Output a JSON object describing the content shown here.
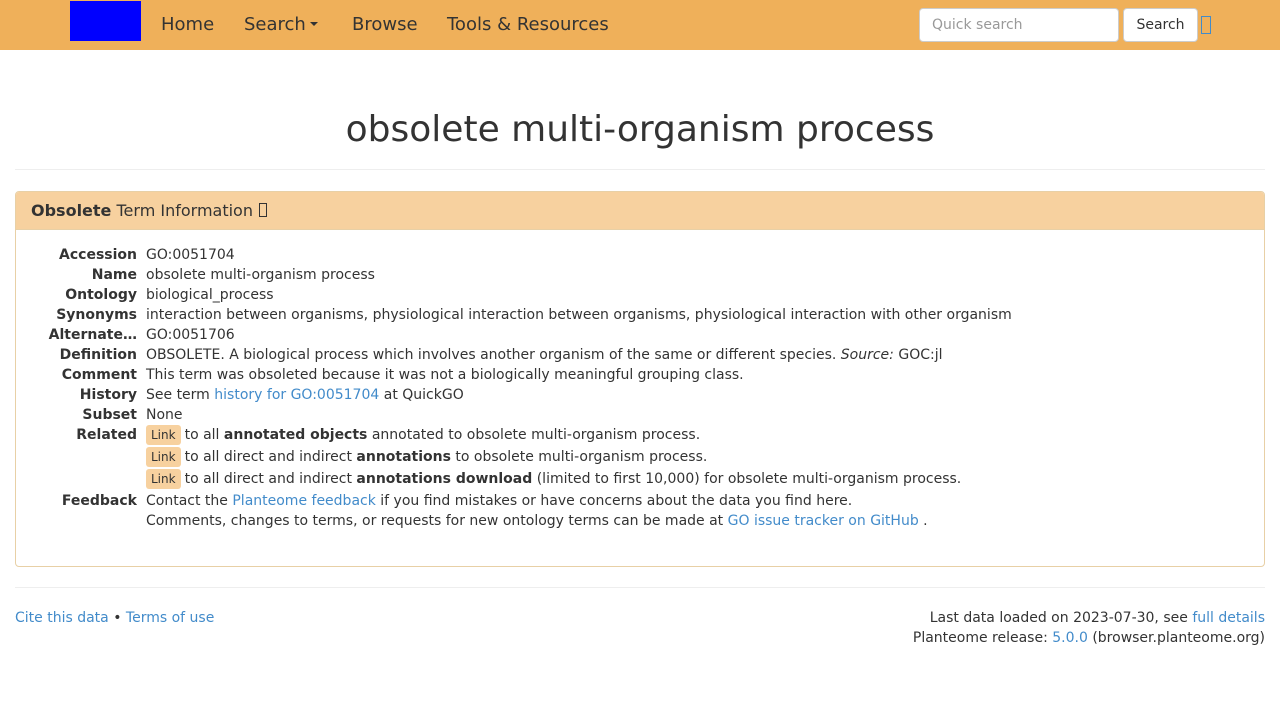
{
  "navbar": {
    "items": [
      {
        "label": "Home"
      },
      {
        "label": "Search"
      },
      {
        "label": "Browse"
      },
      {
        "label": "Tools & Resources"
      }
    ],
    "search_placeholder": "Quick search",
    "search_button": "Search",
    "colors": {
      "bar": "#efb05a",
      "logo": "#0000ff"
    }
  },
  "page_title": "obsolete multi-organism process",
  "panel": {
    "heading_bold": "Obsolete",
    "heading_rest": "Term Information",
    "fields": {
      "accession": {
        "label": "Accession",
        "value": "GO:0051704"
      },
      "name": {
        "label": "Name",
        "value": "obsolete multi-organism process"
      },
      "ontology": {
        "label": "Ontology",
        "value": "biological_process"
      },
      "synonyms": {
        "label": "Synonyms",
        "value": "interaction between organisms, physiological interaction between organisms, physiological interaction with other organism"
      },
      "alternate": {
        "label": "Alternate…",
        "value": "GO:0051706"
      },
      "definition": {
        "label": "Definition",
        "value": "OBSOLETE. A biological process which involves another organism of the same or different species.",
        "source_label": "Source:",
        "source_value": "GOC:jl"
      },
      "comment": {
        "label": "Comment",
        "value": "This term was obsoleted because it was not a biologically meaningful grouping class."
      },
      "history": {
        "label": "History",
        "prefix": "See term",
        "link": "history for GO:0051704",
        "suffix": "at QuickGO"
      },
      "subset": {
        "label": "Subset",
        "value": "None"
      },
      "related": {
        "label": "Related",
        "rows": [
          {
            "badge": "Link",
            "pre": "to all",
            "bold": "annotated objects",
            "post": "annotated to obsolete multi-organism process."
          },
          {
            "badge": "Link",
            "pre": "to all direct and indirect",
            "bold": "annotations",
            "post": "to obsolete multi-organism process."
          },
          {
            "badge": "Link",
            "pre": "to all direct and indirect",
            "bold": "annotations download",
            "post": "(limited to first 10,000) for obsolete multi-organism process."
          }
        ]
      },
      "feedback": {
        "label": "Feedback",
        "line1_pre": "Contact the",
        "line1_link": "Planteome feedback",
        "line1_post": "if you find mistakes or have concerns about the data you find here.",
        "line2_pre": "Comments, changes to terms, or requests for new ontology terms can be made at",
        "line2_link": "GO issue tracker on GitHub",
        "line2_post": "."
      }
    }
  },
  "footer": {
    "cite": "Cite this data",
    "sep": "•",
    "terms": "Terms of use",
    "loaded_pre": "Last data loaded on 2023-07-30, see",
    "loaded_link": "full details",
    "release_pre": "Planteome release:",
    "release_link": "5.0.0",
    "release_post": "(browser.planteome.org)"
  }
}
